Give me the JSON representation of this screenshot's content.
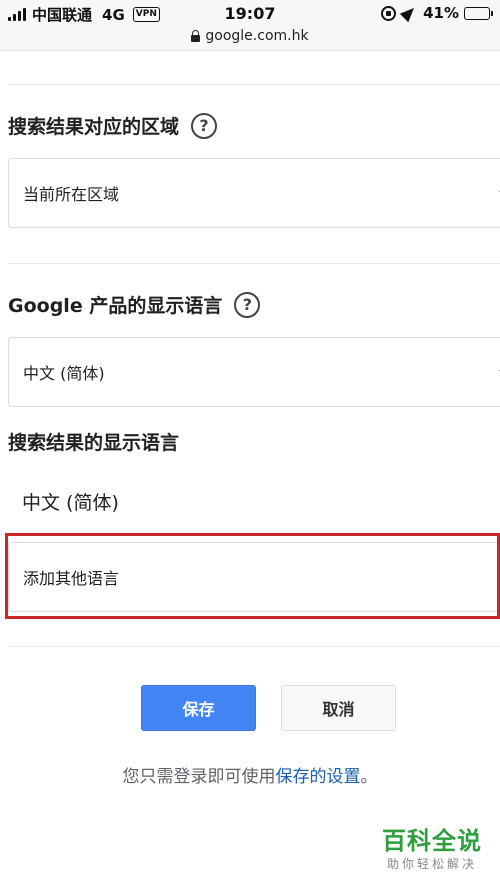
{
  "status_bar": {
    "carrier": "中国联通",
    "network": "4G",
    "vpn": "VPN",
    "time": "19:07",
    "battery_pct": "41%",
    "battery_level": 0.41
  },
  "url_bar": {
    "domain": "google.com.hk"
  },
  "region": {
    "title": "搜索结果对应的区域",
    "help": "?",
    "selected": "当前所在区域"
  },
  "display_language": {
    "title": "Google 产品的显示语言",
    "help": "?",
    "selected": "中文 (简体)"
  },
  "search_language": {
    "title": "搜索结果的显示语言",
    "current": "中文 (简体)",
    "add_label": "添加其他语言"
  },
  "actions": {
    "save_label": "保存",
    "cancel_label": "取消"
  },
  "login_note": {
    "prefix": "您只需登录即可使用",
    "link": "保存的设置",
    "suffix": "。"
  },
  "watermark": {
    "title": "百科全说",
    "subtitle": "助你轻松解决"
  },
  "colors": {
    "primary_button": "#4285f4",
    "highlight_border": "#c62828",
    "link": "#1a5fb4",
    "watermark": "#2e9e3e"
  }
}
